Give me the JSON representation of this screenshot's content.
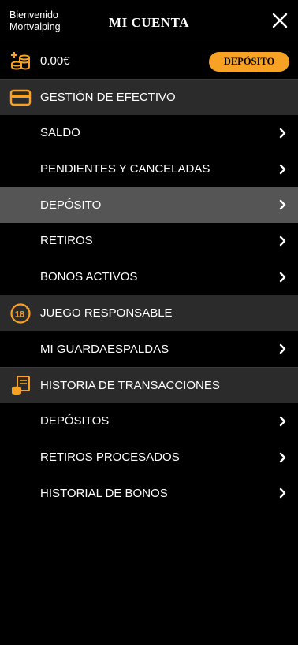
{
  "header": {
    "welcome_line1": "Bienvenido",
    "welcome_line2": "Mortvalping",
    "title": "MI CUENTA",
    "close_icon": "close-icon"
  },
  "wallet": {
    "balance": "0.00€",
    "deposit_button": "DEPÓSITO",
    "icon": "coins-plus-icon",
    "accent_color": "#f7a224"
  },
  "sections": [
    {
      "label": "GESTIÓN DE EFECTIVO",
      "icon": "credit-card-icon",
      "items": [
        {
          "label": "SALDO",
          "active": false
        },
        {
          "label": "PENDIENTES Y CANCELADAS",
          "active": false
        },
        {
          "label": "DEPÓSITO",
          "active": true
        },
        {
          "label": "RETIROS",
          "active": false
        },
        {
          "label": "BONOS ACTIVOS",
          "active": false
        }
      ]
    },
    {
      "label": "JUEGO RESPONSABLE",
      "icon": "age-18-plus-icon",
      "items": [
        {
          "label": "MI GUARDAESPALDAS",
          "active": false
        }
      ]
    },
    {
      "label": "HISTORIA DE TRANSACCIONES",
      "icon": "transaction-history-icon",
      "items": [
        {
          "label": "DEPÓSITOS",
          "active": false
        },
        {
          "label": "RETIROS PROCESADOS",
          "active": false
        },
        {
          "label": "HISTORIAL DE BONOS",
          "active": false
        }
      ]
    }
  ]
}
